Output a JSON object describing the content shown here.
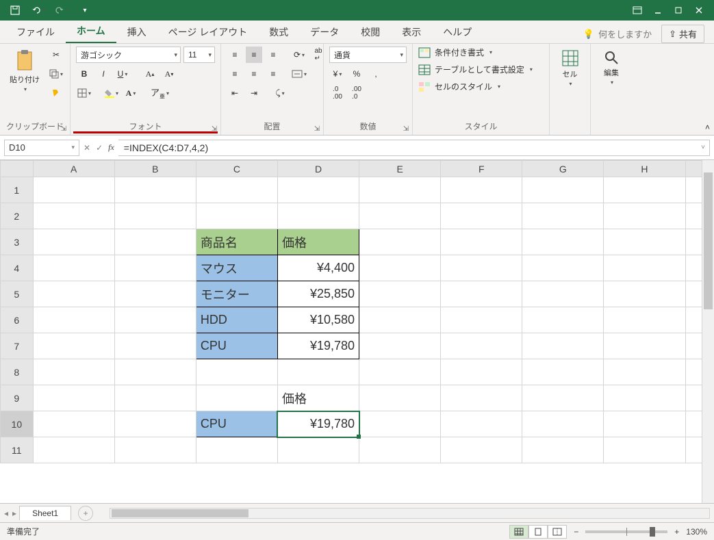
{
  "qat": {
    "save": "save",
    "undo": "undo",
    "redo": "redo"
  },
  "tabs": {
    "file": "ファイル",
    "home": "ホーム",
    "insert": "挿入",
    "page_layout": "ページ レイアウト",
    "formulas": "数式",
    "data": "データ",
    "review": "校閲",
    "view": "表示",
    "help": "ヘルプ",
    "tell_me": "何をしますか",
    "share": "共有"
  },
  "ribbon": {
    "clipboard": {
      "paste": "貼り付け",
      "label": "クリップボード"
    },
    "font": {
      "name": "游ゴシック",
      "size": "11",
      "bold": "B",
      "italic": "I",
      "underline": "U",
      "label": "フォント"
    },
    "alignment": {
      "label": "配置"
    },
    "number": {
      "format": "通貨",
      "label": "数値"
    },
    "styles": {
      "cond": "条件付き書式",
      "table": "テーブルとして書式設定",
      "cell": "セルのスタイル",
      "label": "スタイル"
    },
    "cells": {
      "cell": "セル"
    },
    "editing": {
      "edit": "編集"
    }
  },
  "formula_bar": {
    "cell_ref": "D10",
    "formula": "=INDEX(C4:D7,4,2)"
  },
  "columns": [
    "A",
    "B",
    "C",
    "D",
    "E",
    "F",
    "G",
    "H"
  ],
  "rows": [
    "1",
    "2",
    "3",
    "4",
    "5",
    "6",
    "7",
    "8",
    "9",
    "10",
    "11"
  ],
  "cells": {
    "C3": "商品名",
    "D3": "価格",
    "C4": "マウス",
    "D4": "¥4,400",
    "C5": "モニター",
    "D5": "¥25,850",
    "C6": "HDD",
    "D6": "¥10,580",
    "C7": "CPU",
    "D7": "¥19,780",
    "D9": "価格",
    "C10": "CPU",
    "D10": "¥19,780"
  },
  "sheet": {
    "name": "Sheet1"
  },
  "status": {
    "ready": "準備完了",
    "zoom": "130%"
  },
  "chart_data": {
    "type": "table",
    "headers": [
      "商品名",
      "価格"
    ],
    "rows": [
      [
        "マウス",
        4400
      ],
      [
        "モニター",
        25850
      ],
      [
        "HDD",
        10580
      ],
      [
        "CPU",
        19780
      ]
    ],
    "lookup_result": {
      "label": "価格",
      "item": "CPU",
      "value": 19780
    }
  }
}
